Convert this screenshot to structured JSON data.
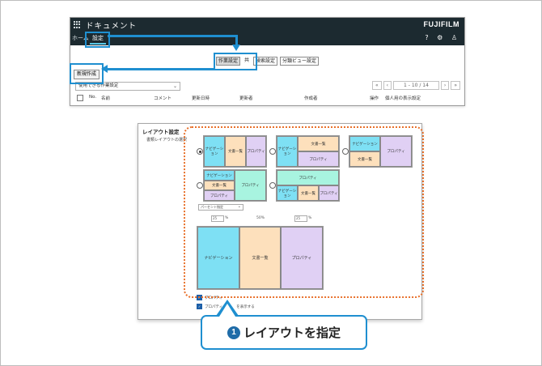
{
  "app": {
    "title": "ドキュメント",
    "brand": "FUJIFILM",
    "nav_home": "ホーム",
    "nav_settings": "設定",
    "nav_icons": "? ⚙ ♙",
    "tabs": [
      {
        "label": "作業設定",
        "active": true
      },
      {
        "label": "共",
        "active": false
      },
      {
        "label": "検索設定",
        "active": false
      },
      {
        "label": "分類ビュー設定",
        "active": false
      }
    ],
    "new_button": "新規作成",
    "filter_select": "使用できる作業設定",
    "pager": {
      "first": "«",
      "prev": "‹",
      "range": "1 - 10 / 14",
      "next": "›",
      "last": "»"
    },
    "columns": [
      "No.",
      "名前",
      "コメント",
      "更新日時",
      "更新者",
      "作成者",
      "操作",
      "個人用の表示設定"
    ]
  },
  "dialog": {
    "title": "レイアウト設定",
    "subtitle": "書類レイアウトの選択",
    "layouts": [
      {
        "cells": [
          "ナビゲーション",
          "文書一覧",
          "プロパティ"
        ],
        "selected": true
      },
      {
        "cells": [
          "ナビゲーション",
          "文書一覧",
          "プロパティ"
        ],
        "selected": false
      },
      {
        "cells": [
          "ナビゲーション",
          "文書一覧",
          "プロパティ"
        ],
        "selected": false
      },
      {
        "cells": [
          "ナビゲーション",
          "文書一覧",
          "プロパティ"
        ],
        "selected": false
      },
      {
        "cells": [
          "プロパティ",
          "ナビゲーション",
          "文書一覧",
          "プロパティ"
        ],
        "selected": false
      }
    ],
    "mode_select": "パーセント指定",
    "pct_left": "25",
    "pct_mid": "50%",
    "pct_right": "25",
    "pct_unit": "%",
    "preview": [
      "ナビゲーション",
      "文書一覧",
      "プロパティ"
    ],
    "checkbox1": "プロパティ",
    "checkbox1_tail": "を表示する"
  },
  "callout": {
    "number": "1",
    "text": "レイアウトを指定"
  },
  "colors": {
    "accent_blue": "#1f8fd0",
    "orange_dash": "#e8702a",
    "header_dark": "#1c2a30",
    "nav_cell": "#7ee0f4",
    "list_cell": "#fde0bc",
    "prop_cell": "#e0d0f4"
  }
}
